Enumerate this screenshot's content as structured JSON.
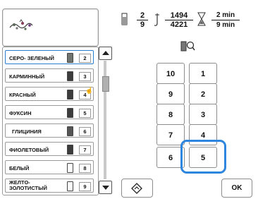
{
  "status": {
    "color_current": "2",
    "color_total": "9",
    "stitch_current": "1494",
    "stitch_total": "4221",
    "time_current": "2 min",
    "time_total": "9 min"
  },
  "colors": [
    {
      "name": "СЕРО- ЗЕЛЕНЫЙ",
      "num": "2",
      "fill": "#6f7470",
      "selected": true
    },
    {
      "name": "КАРМИННЫЙ",
      "num": "3",
      "fill": "#3c3c3c"
    },
    {
      "name": "КРАСНЫЙ",
      "num": "4",
      "fill": "#3c3c3c"
    },
    {
      "name": "ФУКСИН",
      "num": "5",
      "fill": "#3c3c3c"
    },
    {
      "name": "ГЛИЦИНИЯ",
      "num": "6",
      "fill": "#555555"
    },
    {
      "name": "ФИОЛЕТОВЫЙ",
      "num": "7",
      "fill": "#3c3c3c"
    },
    {
      "name": "БЕЛЫЙ",
      "num": "8",
      "fill": "#ffffff"
    },
    {
      "name": "ЖЕЛТО-ЗОЛОТИСТЫЙ",
      "name_line1": "ЖЕЛТО-",
      "name_line2": "ЗОЛОТИСТЫЙ",
      "num": "9",
      "fill": "#ffffff"
    }
  ],
  "grid": {
    "left_col": [
      "10",
      "9",
      "8",
      "7",
      "6"
    ],
    "right_col": [
      "1",
      "2",
      "3",
      "4",
      "5"
    ],
    "highlighted": "5"
  },
  "buttons": {
    "ok_label": "OK",
    "reset_icon": "reset-diamond-icon"
  },
  "accent_color": "#2e86de"
}
